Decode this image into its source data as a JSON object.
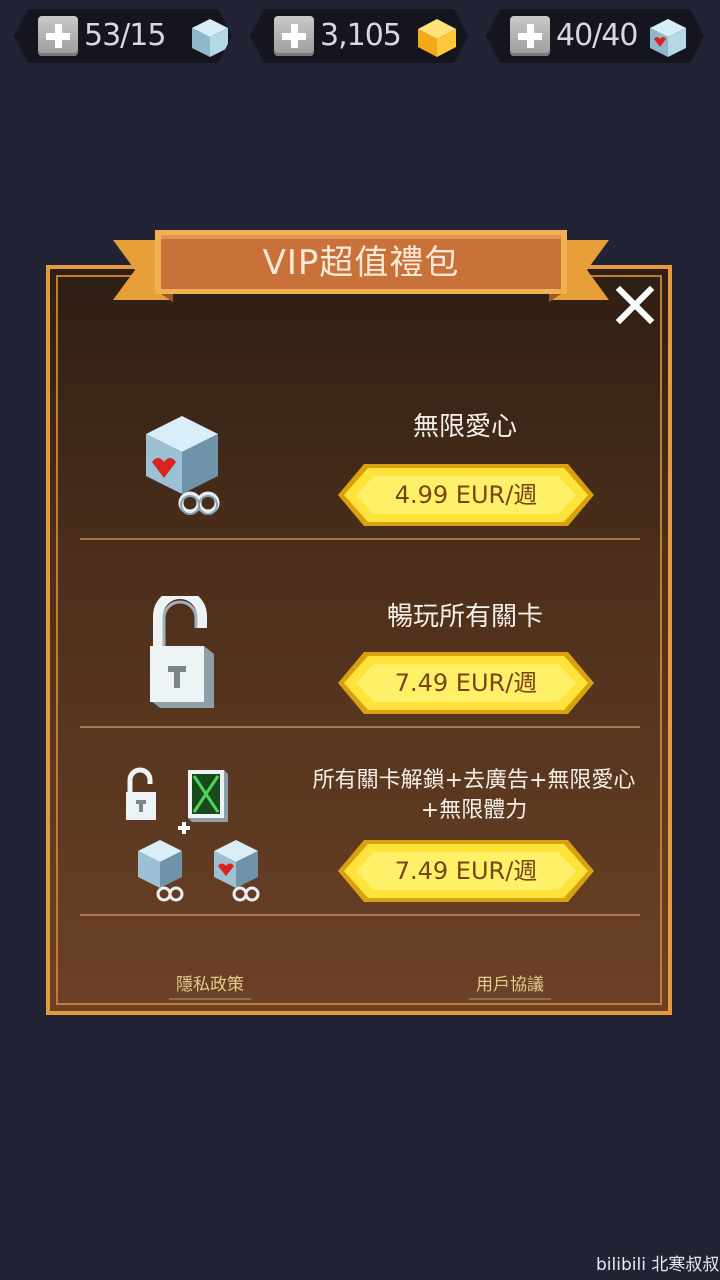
{
  "resources": [
    {
      "value": "53/15",
      "icon": "cube-icon"
    },
    {
      "value": "3,105",
      "icon": "gold-cube-icon"
    },
    {
      "value": "40/40",
      "icon": "heart-cube-icon"
    }
  ],
  "dialog": {
    "title": "VIP超值禮包",
    "close_icon": "close-icon",
    "offers": [
      {
        "title": "無限愛心",
        "price": "4.99 EUR/週",
        "icon": "infinite-heart-cube-icon"
      },
      {
        "title": "暢玩所有關卡",
        "price": "7.49 EUR/週",
        "icon": "unlocked-padlock-icon"
      },
      {
        "title_line1": "所有關卡解鎖+去廣告+無限愛心",
        "title_line2": "+無限體力",
        "price": "7.49 EUR/週",
        "icon": "bundle-icon"
      }
    ],
    "links": {
      "privacy": "隱私政策",
      "terms": "用戶協議"
    }
  },
  "watermark": "bilibili 北寒叔叔",
  "colors": {
    "background": "#222335",
    "panel_border": "#e59a3e",
    "price_button": "#ffe23a",
    "banner": "#c8713a"
  }
}
